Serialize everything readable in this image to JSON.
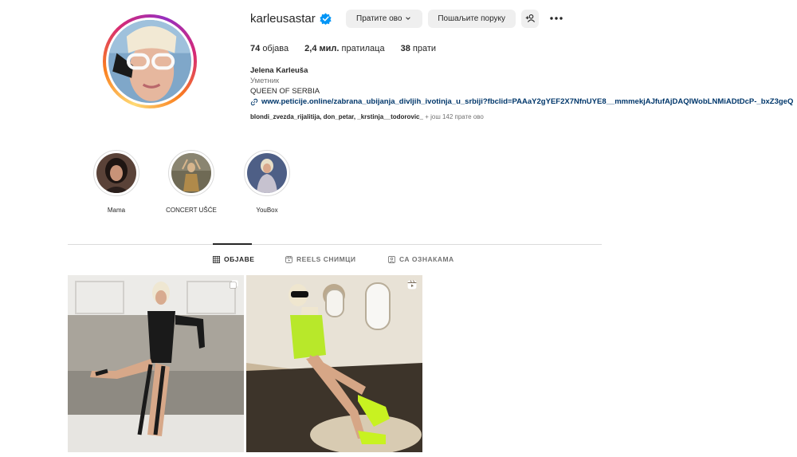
{
  "profile": {
    "username": "karleusastar",
    "follow_label": "Пратите ово",
    "message_label": "Пошаљите поруку",
    "stats": {
      "posts_count": "74",
      "posts_label": "објава",
      "followers_count": "2,4 мил.",
      "followers_label": "пратилаца",
      "following_count": "38",
      "following_label": "прати"
    },
    "bio": {
      "full_name": "Jelena Karleuša",
      "category": "Уметник",
      "tagline": "QUEEN OF SERBIA",
      "link": "www.peticije.online/zabrana_ubijanja_divljih_ivotinja_u_srbiji?fbclid=PAAaY2gYEF2X7NfnUYE8__mmmekjAJfufAjDAQIWobLNMiADtDcP-_bxZ3geQ"
    },
    "followed_by": {
      "names": "blondi_zvezda_rijalitija, don_petar, _krstinja__todorovic_",
      "more": " + још 142 прате ово"
    }
  },
  "highlights": [
    {
      "label": "Mama"
    },
    {
      "label": "CONCERT UŠĆE"
    },
    {
      "label": "YouBox"
    }
  ],
  "tabs": {
    "posts": "ОБЈАВЕ",
    "reels": "REELS СНИМЦИ",
    "tagged": "СА ОЗНАКАМА"
  },
  "colors": {
    "verified": "#0095f6",
    "link": "#00376b",
    "button_bg": "#efefef",
    "secondary_text": "#737373"
  },
  "icons": [
    "verified-badge-icon",
    "chevron-down-icon",
    "add-person-icon",
    "more-icon",
    "link-icon",
    "grid-icon",
    "reels-icon",
    "tagged-icon",
    "carousel-icon",
    "reel-post-icon"
  ]
}
